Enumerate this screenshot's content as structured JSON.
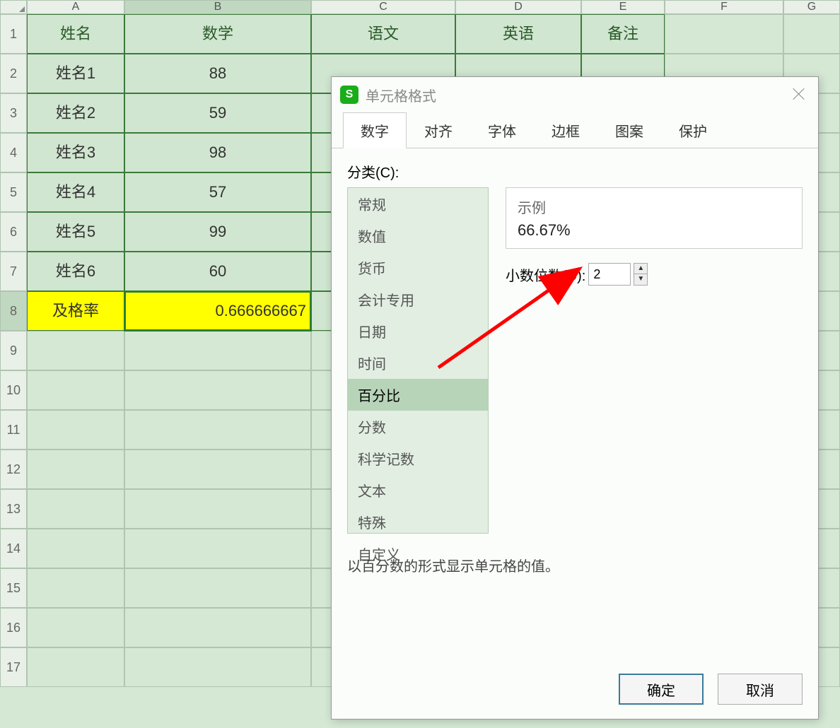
{
  "columns": [
    "A",
    "B",
    "C",
    "D",
    "E",
    "F",
    "G"
  ],
  "selected_col": "B",
  "selected_row": 8,
  "grid": {
    "headers": [
      "姓名",
      "数学",
      "语文",
      "英语",
      "备注"
    ],
    "rows": [
      {
        "name": "姓名1",
        "math": "88"
      },
      {
        "name": "姓名2",
        "math": "59"
      },
      {
        "name": "姓名3",
        "math": "98"
      },
      {
        "name": "姓名4",
        "math": "57"
      },
      {
        "name": "姓名5",
        "math": "99"
      },
      {
        "name": "姓名6",
        "math": "60"
      }
    ],
    "summary": {
      "label": "及格率",
      "value": "0.666666667"
    }
  },
  "dialog": {
    "icon_text": "S",
    "title": "单元格格式",
    "tabs": [
      "数字",
      "对齐",
      "字体",
      "边框",
      "图案",
      "保护"
    ],
    "active_tab": 0,
    "category_label": "分类(C):",
    "categories": [
      "常规",
      "数值",
      "货币",
      "会计专用",
      "日期",
      "时间",
      "百分比",
      "分数",
      "科学记数",
      "文本",
      "特殊",
      "自定义"
    ],
    "selected_category": 6,
    "example_label": "示例",
    "example_value": "66.67%",
    "decimal_label": "小数位数(D):",
    "decimal_value": "2",
    "description": "以百分数的形式显示单元格的值。",
    "ok": "确定",
    "cancel": "取消"
  }
}
